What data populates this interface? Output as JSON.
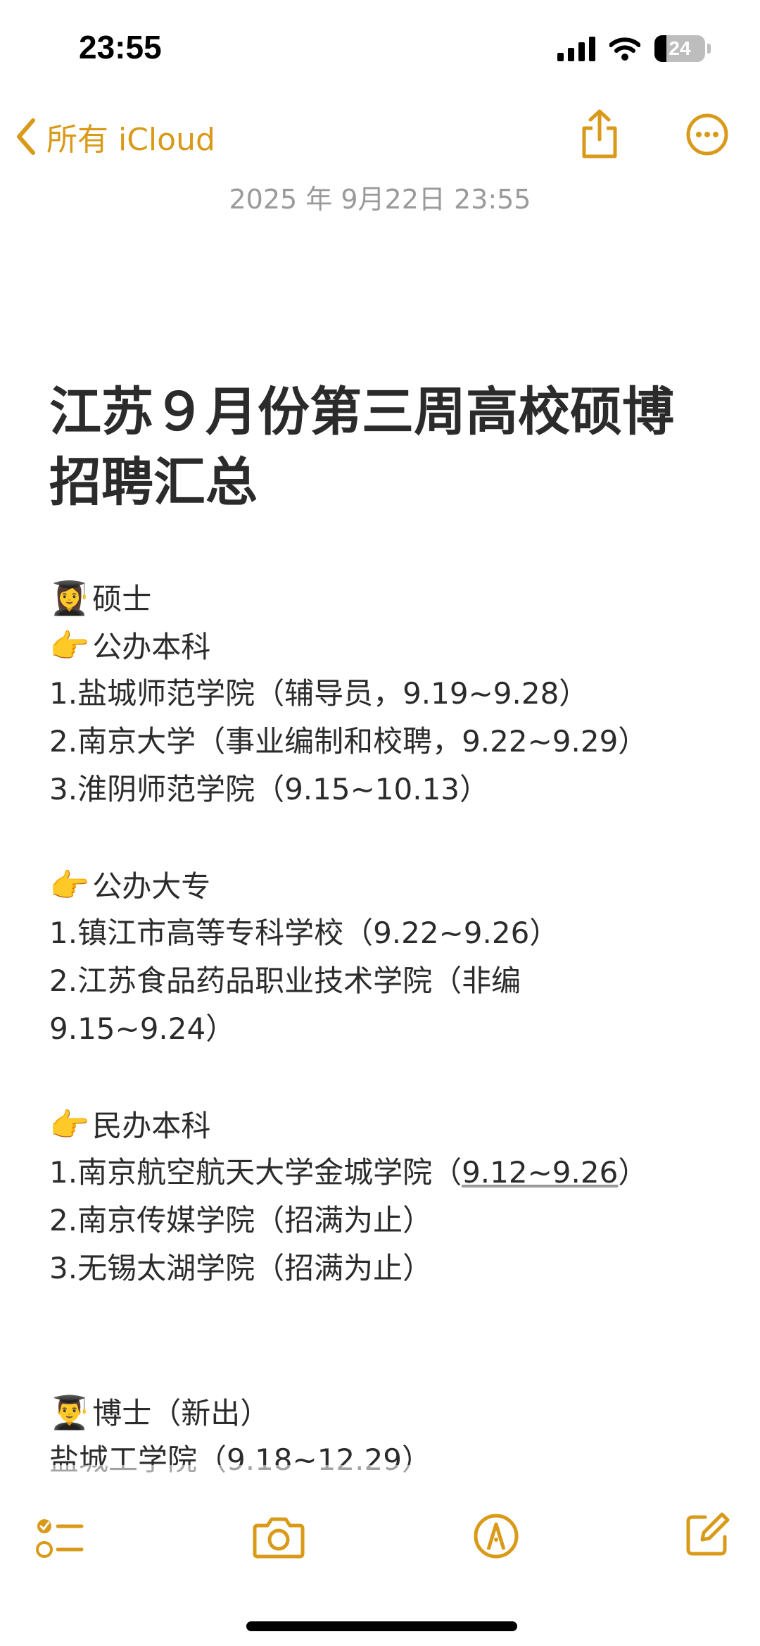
{
  "status_bar": {
    "time": "23:55",
    "battery": "24",
    "battery_level": 0.24
  },
  "nav": {
    "back_label": "所有 iCloud"
  },
  "note": {
    "date": "2025 年 9月22日 23:55",
    "title_lines": [
      "江苏９月份第三周高校硕博",
      "招聘汇总"
    ],
    "master": {
      "emoji": "👩‍🎓",
      "label": "硕士",
      "sections": [
        {
          "emoji": "👉",
          "label": "公办本科",
          "items": [
            "1.盐城师范学院（辅导员，9.19~9.28）",
            "2.南京大学（事业编制和校聘，9.22~9.29）",
            "3.淮阴师范学院（9.15~10.13）"
          ]
        },
        {
          "emoji": "👉",
          "label": "公办大专",
          "items": [
            "1.镇江市高等专科学校（9.22~9.26）",
            "2.江苏食品药品职业技术学院（非编",
            "9.15~9.24）"
          ]
        },
        {
          "emoji": "👉",
          "label": "民办本科",
          "items": [
            "2.南京传媒学院（招满为止）",
            "3.无锡太湖学院（招满为止）"
          ]
        }
      ],
      "underlined_item": {
        "before": "1.南京航空航天大学金城学院（",
        "underlined": "9.12~9.26",
        "after": "）"
      }
    },
    "phd": {
      "emoji": "👨‍🎓",
      "label": "博士（新出）",
      "items": [
        "盐城工学院（9.18~12.29）"
      ]
    }
  }
}
